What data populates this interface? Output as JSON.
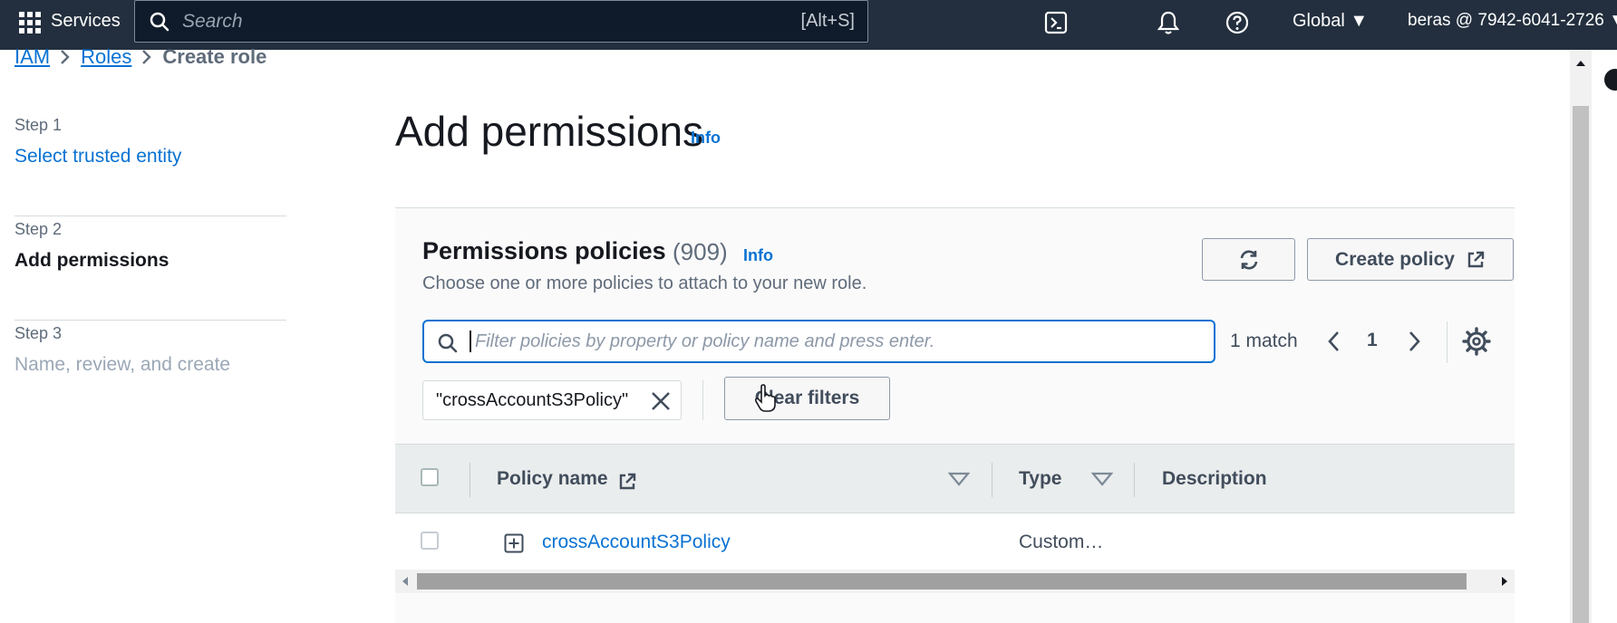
{
  "topnav": {
    "services_label": "Services",
    "search_placeholder": "Search",
    "search_shortcut": "[Alt+S]",
    "region_label": "Global ▼",
    "account_label": "beras @ 7942-6041-2726 ▼",
    "bg_color": "#232f3e"
  },
  "breadcrumb": {
    "items": [
      "IAM",
      "Roles",
      "Create role"
    ]
  },
  "steps": [
    {
      "number": "Step 1",
      "title": "Select trusted entity",
      "state": "link"
    },
    {
      "number": "Step 2",
      "title": "Add permissions",
      "state": "active"
    },
    {
      "number": "Step 3",
      "title": "Name, review, and create",
      "state": "disabled"
    }
  ],
  "page": {
    "title": "Add permissions",
    "info": "Info"
  },
  "policies": {
    "title": "Permissions policies",
    "count": "(909)",
    "info": "Info",
    "description": "Choose one or more policies to attach to your new role.",
    "create_policy_label": "Create policy",
    "filter_placeholder": "Filter policies by property or policy name and press enter.",
    "match_text": "1 match",
    "current_page": "1",
    "filter_token": "\"crossAccountS3Policy\"",
    "clear_filters_label": "Clear filters",
    "columns": [
      "Policy name",
      "Type",
      "Description"
    ],
    "rows": [
      {
        "name": "crossAccountS3Policy",
        "type": "Custom…",
        "description": ""
      }
    ]
  },
  "colors": {
    "link": "#0972d3",
    "focus": "#0972d3"
  }
}
